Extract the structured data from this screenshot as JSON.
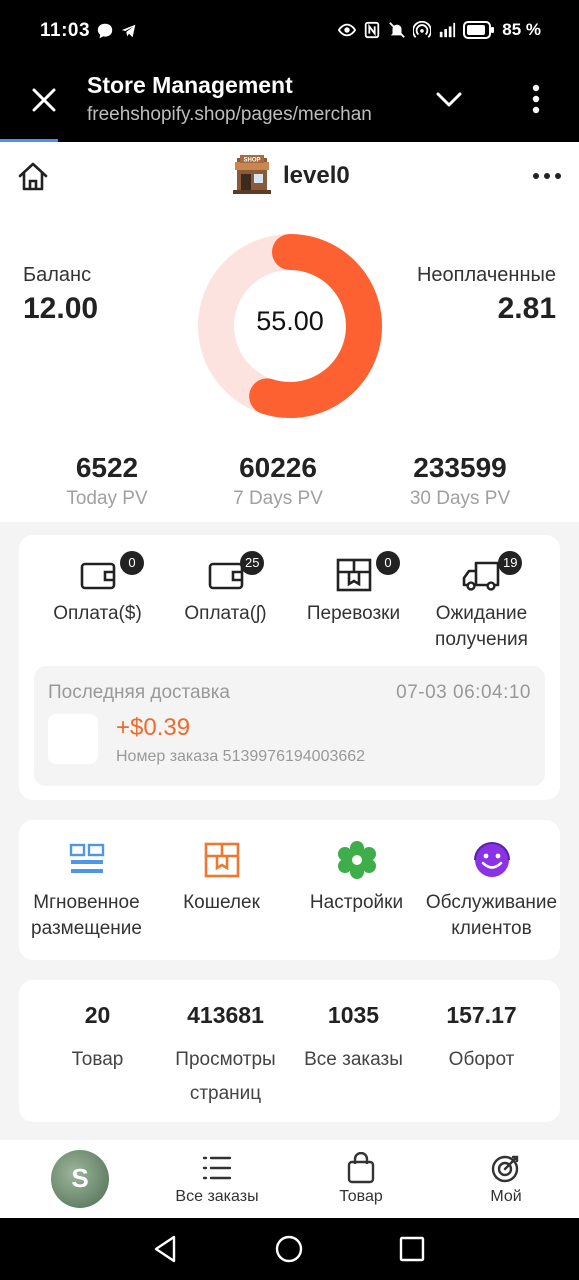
{
  "status_bar": {
    "time": "11:03",
    "battery": "85 %"
  },
  "browser": {
    "title": "Store Management",
    "url": "freehshopify.shop/pages/merchan"
  },
  "header": {
    "level": "level0",
    "store_logo_text": "SHOP"
  },
  "summary": {
    "balance_label": "Баланс",
    "balance_value": "12.00",
    "unpaid_label": "Неоплаченные",
    "unpaid_value": "2.81",
    "donut_center": "55.00",
    "donut_fraction": 0.55,
    "colors": {
      "accent": "#fd6131",
      "track": "#fde3df"
    }
  },
  "pv": [
    {
      "value": "6522",
      "label": "Today PV"
    },
    {
      "value": "60226",
      "label": "7 Days PV"
    },
    {
      "value": "233599",
      "label": "30 Days PV"
    }
  ],
  "orders": [
    {
      "label": "Оплата($)",
      "badge": "0",
      "icon": "wallet-icon"
    },
    {
      "label": "Оплата(ʃ)",
      "badge": "25",
      "icon": "wallet-icon"
    },
    {
      "label": "Перевозки",
      "badge": "0",
      "icon": "box-icon"
    },
    {
      "label": "Ожидание получения",
      "badge": "19",
      "icon": "truck-icon"
    }
  ],
  "last_delivery": {
    "title": "Последняя доставка",
    "time": "07-03 06:04:10",
    "amount": "+$0.39",
    "order": "Номер заказа 5139976194003662"
  },
  "tools": [
    {
      "label": "Мгновенное размещение",
      "icon": "grid-list-icon",
      "color": "#4f95e8"
    },
    {
      "label": "Кошелек",
      "icon": "wallet-box-icon",
      "color": "#f0772e"
    },
    {
      "label": "Настройки",
      "icon": "settings-gear-icon",
      "color": "#3dae4a"
    },
    {
      "label": "Обслуживание клиентов",
      "icon": "support-agent-icon",
      "color": "#8a33e6"
    }
  ],
  "stats": [
    {
      "value": "20",
      "label": "Товар"
    },
    {
      "value": "413681",
      "label": "Просмотры страниц"
    },
    {
      "value": "1035",
      "label": "Все заказы"
    },
    {
      "value": "157.17",
      "label": "Оборот"
    }
  ],
  "tabbar": {
    "avatar_letter": "S",
    "items": [
      {
        "label": "Все заказы",
        "icon": "list-icon"
      },
      {
        "label": "Товар",
        "icon": "shopping-bag-icon"
      },
      {
        "label": "Мой",
        "icon": "target-icon"
      }
    ]
  }
}
